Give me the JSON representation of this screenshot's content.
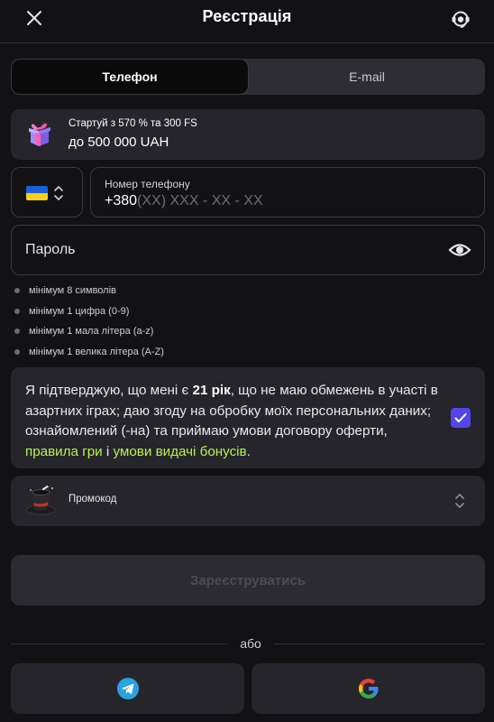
{
  "header": {
    "title": "Реєстрація"
  },
  "tabs": [
    {
      "label": "Телефон",
      "active": true
    },
    {
      "label": "E-mail",
      "active": false
    }
  ],
  "bonus": {
    "line1": "Стартуй з 570 % та 300 FS",
    "line2": "до 500 000 UAH"
  },
  "phone": {
    "country": "Ukraine",
    "label": "Номер телефону",
    "prefix": "+380",
    "mask": "(XX) XXX - XX - XX"
  },
  "password": {
    "placeholder": "Пароль"
  },
  "password_rules": [
    "мінімум 8 символів",
    "мінімум 1 цифра (0-9)",
    "мінімум 1 мала літера (a-z)",
    "мінімум 1 велика літера (A-Z)"
  ],
  "consent": {
    "part1": "Я підтверджую, що мені є ",
    "age": "21 рік",
    "part2": ", що не маю обмежень в участі в азартних іграх; даю згоду на обробку моїх персональних даних; ознайомлений (-на) та приймаю умови договору оферти, ",
    "link1": "правила гри",
    "part3": " і ",
    "link2": "умови видачі бонусів",
    "part4": ".",
    "checked": true
  },
  "promo": {
    "label": "Промокод"
  },
  "submit": {
    "label": "Зареєструватись"
  },
  "divider": {
    "text": "або"
  },
  "social": [
    {
      "icon": "telegram-icon"
    },
    {
      "icon": "google-icon"
    }
  ],
  "colors": {
    "accent": "#5246e8",
    "link": "#b8f34a",
    "background": "#121214",
    "card": "#25252b"
  }
}
